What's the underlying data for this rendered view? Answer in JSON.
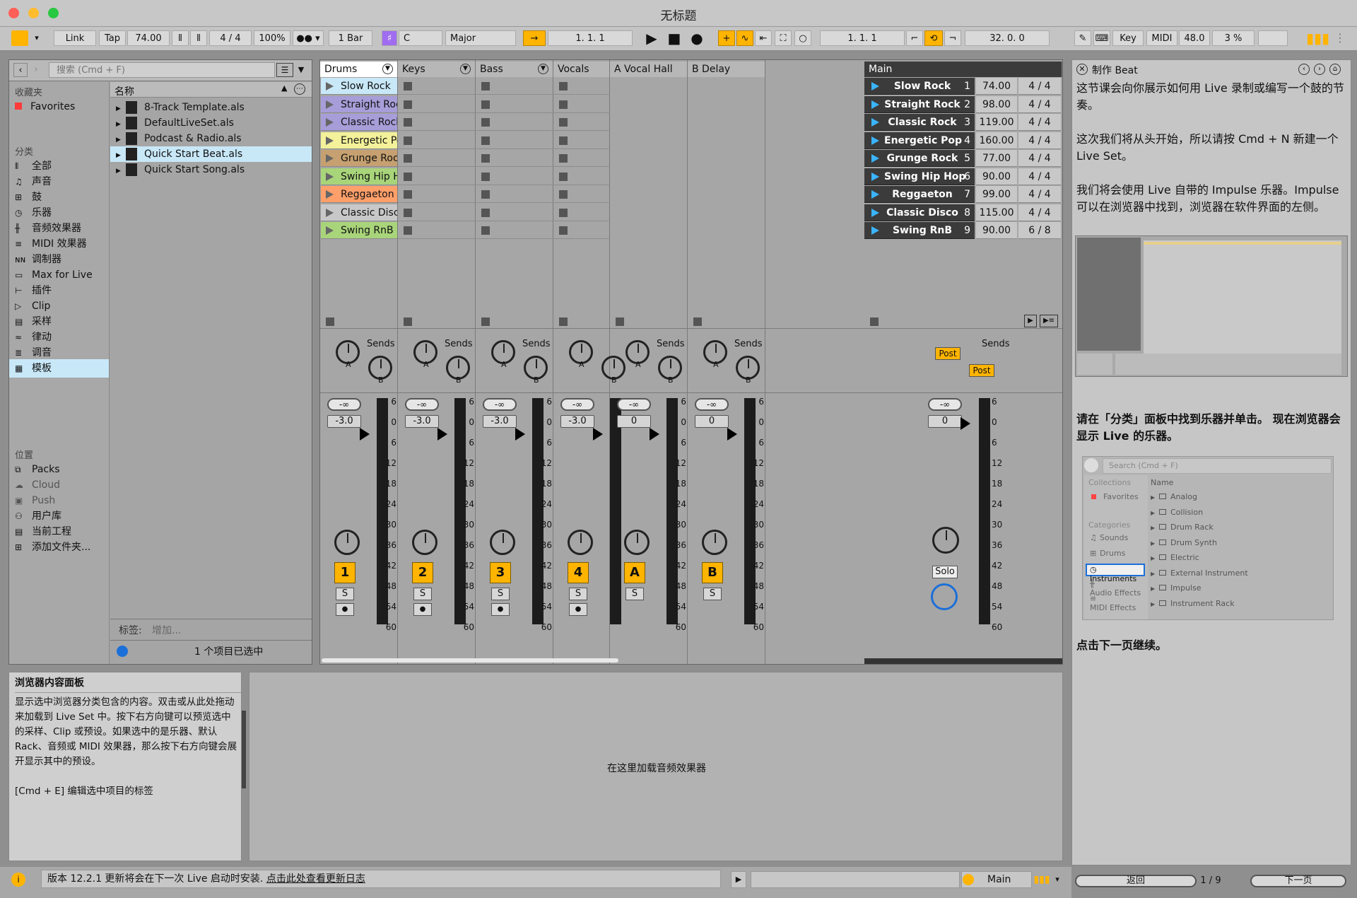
{
  "window": {
    "title": "无标题"
  },
  "control_bar": {
    "link": "Link",
    "tap": "Tap",
    "tempo": "74.00",
    "signature": "4 / 4",
    "zoom": "100%",
    "quantize": "1 Bar",
    "key": "C",
    "scale": "Major",
    "arrangement_position": "1.   1.   1",
    "loop_start": "1.   1.   1",
    "loop_length": "32.   0.   0",
    "key_map": "Key",
    "midi_map": "MIDI",
    "sample_rate": "48.0",
    "cpu": "3 %"
  },
  "browser": {
    "search_placeholder": "搜索 (Cmd + F)",
    "collections_header": "收藏夹",
    "favorites": "Favorites",
    "categories_header": "分类",
    "categories": [
      "全部",
      "声音",
      "鼓",
      "乐器",
      "音频效果器",
      "MIDI 效果器",
      "调制器",
      "Max for Live",
      "插件",
      "Clip",
      "采样",
      "律动",
      "调音",
      "模板"
    ],
    "places_header": "位置",
    "places": [
      "Packs",
      "Cloud",
      "Push",
      "用户库",
      "当前工程",
      "添加文件夹..."
    ],
    "name_header": "名称",
    "files": [
      "8-Track Template.als",
      "DefaultLiveSet.als",
      "Podcast & Radio.als",
      "Quick Start Beat.als",
      "Quick Start Song.als"
    ],
    "tags_label": "标签:",
    "tags_placeholder": "增加...",
    "status": "1 个项目已选中"
  },
  "tracks": [
    {
      "name": "Drums",
      "number": "1",
      "vol": "-3.0"
    },
    {
      "name": "Keys",
      "number": "2",
      "vol": "-3.0"
    },
    {
      "name": "Bass",
      "number": "3",
      "vol": "-3.0"
    },
    {
      "name": "Vocals",
      "number": "4",
      "vol": "-3.0"
    },
    {
      "name": "A Vocal Hall",
      "number": "A",
      "vol": "0"
    },
    {
      "name": "B Delay",
      "number": "B",
      "vol": "0"
    }
  ],
  "main_track": {
    "name": "Main",
    "vol": "0",
    "solo": "Solo",
    "post": "Post"
  },
  "drum_clips": [
    "Slow Rock",
    "Straight Rock",
    "Classic Rock",
    "Energetic Pop",
    "Grunge Rock",
    "Swing Hip Hop",
    "Reggaeton",
    "Classic Disco",
    "Swing RnB"
  ],
  "scenes": [
    {
      "name": "Slow Rock",
      "num": "1",
      "tempo": "74.00",
      "sig": "4 / 4"
    },
    {
      "name": "Straight Rock",
      "num": "2",
      "tempo": "98.00",
      "sig": "4 / 4"
    },
    {
      "name": "Classic Rock",
      "num": "3",
      "tempo": "119.00",
      "sig": "4 / 4"
    },
    {
      "name": "Energetic Pop",
      "num": "4",
      "tempo": "160.00",
      "sig": "4 / 4"
    },
    {
      "name": "Grunge Rock",
      "num": "5",
      "tempo": "77.00",
      "sig": "4 / 4"
    },
    {
      "name": "Swing Hip Hop",
      "num": "6",
      "tempo": "90.00",
      "sig": "4 / 4"
    },
    {
      "name": "Reggaeton",
      "num": "7",
      "tempo": "99.00",
      "sig": "4 / 4"
    },
    {
      "name": "Classic Disco",
      "num": "8",
      "tempo": "115.00",
      "sig": "4 / 4"
    },
    {
      "name": "Swing RnB",
      "num": "9",
      "tempo": "90.00",
      "sig": "6 / 8"
    }
  ],
  "mixer": {
    "sends": "Sends",
    "send_a": "A",
    "send_b": "B",
    "neg_inf": "-∞",
    "solo_s": "S",
    "scale": [
      "6",
      "0",
      "6",
      "12",
      "18",
      "24",
      "30",
      "36",
      "42",
      "48",
      "54",
      "60"
    ]
  },
  "info_panel": {
    "title": "浏览器内容面板",
    "body": "显示选中浏览器分类包含的内容。双击或从此处拖动来加载到 Live Set 中。按下右方向键可以预览选中的采样、Clip 或预设。如果选中的是乐器、默认 Rack、音频或 MIDI 效果器，那么按下右方向键会展开显示其中的预设。",
    "shortcut": "[Cmd + E] 编辑选中项目的标签"
  },
  "device_view": {
    "drop_hint": "在这里加载音频效果器"
  },
  "status_bar": {
    "message": "版本 12.2.1 更新将会在下一次 Live 启动时安装.",
    "link": "点击此处查看更新日志",
    "main": "Main"
  },
  "lesson": {
    "title": "制作 Beat",
    "p1": "这节课会向你展示如何用 Live 录制或编写一个鼓的节奏。",
    "p2": "这次我们将从头开始，所以请按 Cmd + N 新建一个 Live Set。",
    "p3": "我们将会使用 Live 自带的 Impulse 乐器。Impulse 可以在浏览器中找到，浏览器在软件界面的左侧。",
    "p4": "请在「分类」面板中找到乐器并单击。 现在浏览器会显示 Live 的乐器。",
    "p5": "点击下一页继续。",
    "back": "返回",
    "page": "1 / 9",
    "next": "下一页",
    "mini": {
      "search": "Search (Cmd + F)",
      "collections": "Collections",
      "favorites": "Favorites",
      "categories": "Categories",
      "cats": [
        "Sounds",
        "Drums",
        "Instruments",
        "Audio Effects",
        "MIDI Effects"
      ],
      "name": "Name",
      "items": [
        "Analog",
        "Collision",
        "Drum Rack",
        "Drum Synth",
        "Electric",
        "External Instrument",
        "Impulse",
        "Instrument Rack"
      ]
    }
  },
  "colors": {
    "accent": "#ffb400",
    "selection": "#c8e8f8",
    "scene_arrow": "#3ab4ff"
  }
}
